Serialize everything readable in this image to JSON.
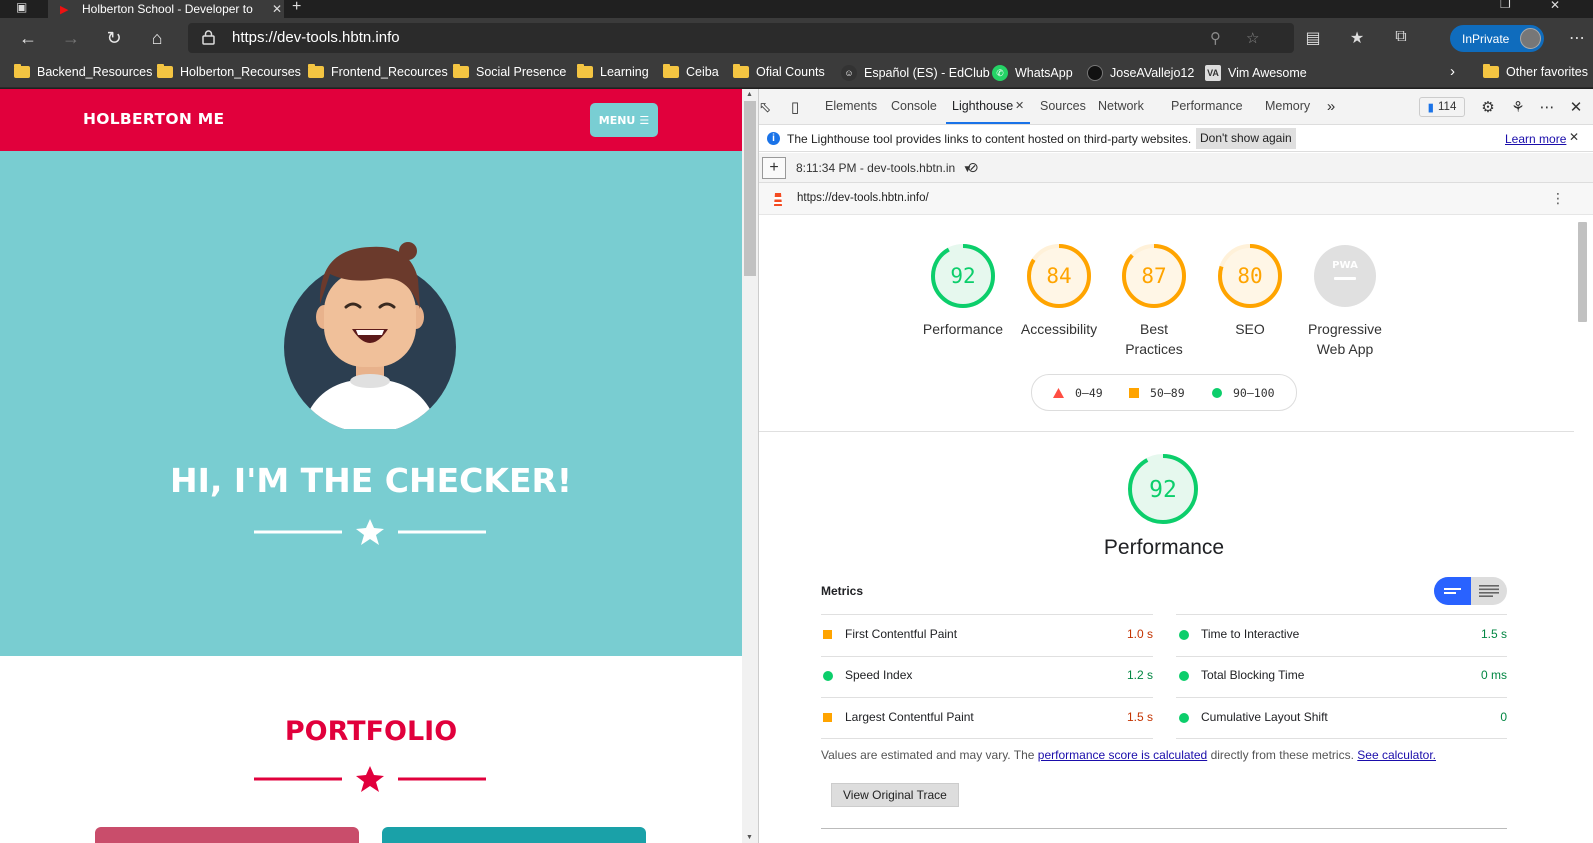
{
  "browser": {
    "tab_title": "Holberton School - Developer to",
    "url": "https://dev-tools.hbtn.info",
    "inprivate_label": "InPrivate",
    "bookmarks": [
      {
        "label": "Backend_Resources",
        "icon": "folder-icon"
      },
      {
        "label": "Holberton_Recourses",
        "icon": "folder-icon"
      },
      {
        "label": "Frontend_Recources",
        "icon": "folder-icon"
      },
      {
        "label": "Social Presence",
        "icon": "folder-icon"
      },
      {
        "label": "Learning",
        "icon": "folder-icon"
      },
      {
        "label": "Ceiba",
        "icon": "folder-icon"
      },
      {
        "label": "Ofial Counts",
        "icon": "folder-icon"
      },
      {
        "label": "Español (ES) - EdClub",
        "icon": "edclub-icon"
      },
      {
        "label": "WhatsApp",
        "icon": "whatsapp-icon"
      },
      {
        "label": "JoseAVallejo12",
        "icon": "github-icon"
      },
      {
        "label": "Vim Awesome",
        "icon": "vim-awesome-icon"
      }
    ],
    "other_favorites": "Other favorites"
  },
  "site": {
    "logo": "HOLBERTON ME",
    "menu_label": "MENU",
    "hero_title": "HI, I'M THE CHECKER!",
    "portfolio_title": "PORTFOLIO",
    "colors": {
      "header": "#e1003c",
      "hero": "#79cdd1",
      "accent": "#e1003c"
    }
  },
  "devtools": {
    "tabs": [
      "Elements",
      "Console",
      "Lighthouse",
      "Sources",
      "Network",
      "Performance",
      "Memory"
    ],
    "active_tab": "Lighthouse",
    "issues_count": "114",
    "infobar_text": "The Lighthouse tool provides links to content hosted on third-party websites.",
    "dont_show_label": "Don't show again",
    "learn_more_label": "Learn more",
    "report_label": "8:11:34 PM - dev-tools.hbtn.in",
    "report_url": "https://dev-tools.hbtn.info/"
  },
  "lighthouse": {
    "categories": [
      {
        "label": "Performance",
        "score": 92,
        "color": "#0cce6b"
      },
      {
        "label": "Accessibility",
        "score": 84,
        "color": "#ffa400"
      },
      {
        "label": "Best Practices",
        "score": 87,
        "color": "#ffa400"
      },
      {
        "label": "SEO",
        "score": 80,
        "color": "#ffa400"
      },
      {
        "label": "Progressive Web App",
        "score": null,
        "badge": "PWA"
      }
    ],
    "legend": {
      "fail": "0–49",
      "average": "50–89",
      "pass": "90–100"
    },
    "section_title": "Performance",
    "section_score": 92,
    "metrics_heading": "Metrics",
    "metrics": [
      {
        "name": "First Contentful Paint",
        "value": "1.0 s",
        "status": "average"
      },
      {
        "name": "Time to Interactive",
        "value": "1.5 s",
        "status": "pass"
      },
      {
        "name": "Speed Index",
        "value": "1.2 s",
        "status": "pass"
      },
      {
        "name": "Total Blocking Time",
        "value": "0 ms",
        "status": "pass"
      },
      {
        "name": "Largest Contentful Paint",
        "value": "1.5 s",
        "status": "average"
      },
      {
        "name": "Cumulative Layout Shift",
        "value": "0",
        "status": "pass"
      }
    ],
    "estimate_prefix": "Values are estimated and may vary. The",
    "estimate_link": "performance score is calculated",
    "estimate_middle": "directly from these metrics.",
    "estimate_link2": "See calculator.",
    "view_trace_label": "View Original Trace"
  }
}
